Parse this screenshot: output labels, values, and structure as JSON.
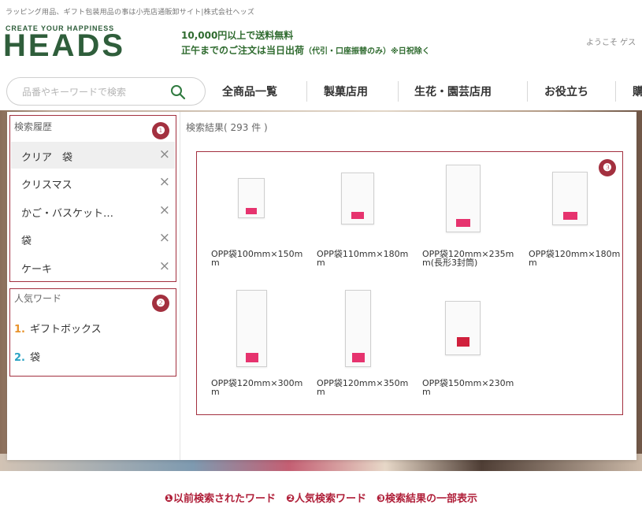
{
  "header": {
    "tagline": "ラッピング用品、ギフト包装用品の事は小売店通販卸サイト|株式会社ヘッズ",
    "logo_sub": "CREATE YOUR HAPPINESS",
    "logo_main": "HEADS",
    "shipping_line1": "10,000円以上で送料無料",
    "shipping_line2_main": "正午までのご注文は当日出荷",
    "shipping_line2_note": "（代引・口座振替のみ）※日祝除く",
    "welcome": "ようこそ ゲス"
  },
  "search": {
    "placeholder": "品番やキーワードで検索",
    "icon": "search-icon"
  },
  "nav": {
    "items": [
      "全商品一覧",
      "製菓店用",
      "生花・園芸店用",
      "お役立ち",
      "購"
    ]
  },
  "history": {
    "title": "検索履歴",
    "badge": "❶",
    "items": [
      "クリア　袋",
      "クリスマス",
      "かご・バスケット…",
      "袋",
      "ケーキ"
    ],
    "remove_icon": "×"
  },
  "popular": {
    "title": "人気ワード",
    "badge": "❷",
    "items": [
      {
        "rank": "1.",
        "label": "ギフトボックス",
        "color": "#e8932c"
      },
      {
        "rank": "2.",
        "label": "袋",
        "color": "#2aa3c4"
      }
    ]
  },
  "results": {
    "title": "検索結果",
    "count": "( 293 件 )",
    "badge": "❸",
    "products": [
      {
        "name": "OPP袋100mm×150mm"
      },
      {
        "name": "OPP袋110mm×180mm"
      },
      {
        "name": "OPP袋120mm×235mm(長形3封筒)"
      },
      {
        "name": "OPP袋120mm×180mm"
      },
      {
        "name": "OPP袋120mm×300mm"
      },
      {
        "name": "OPP袋120mm×350mm"
      },
      {
        "name": "OPP袋150mm×230mm"
      }
    ]
  },
  "caption": "❶以前検索されたワード　❷人気検索ワード　❸検索結果の一部表示",
  "colors": {
    "brand_green": "#2f5e3b",
    "annotation_red": "#a3303f",
    "tag_pink": "#e6336e"
  }
}
